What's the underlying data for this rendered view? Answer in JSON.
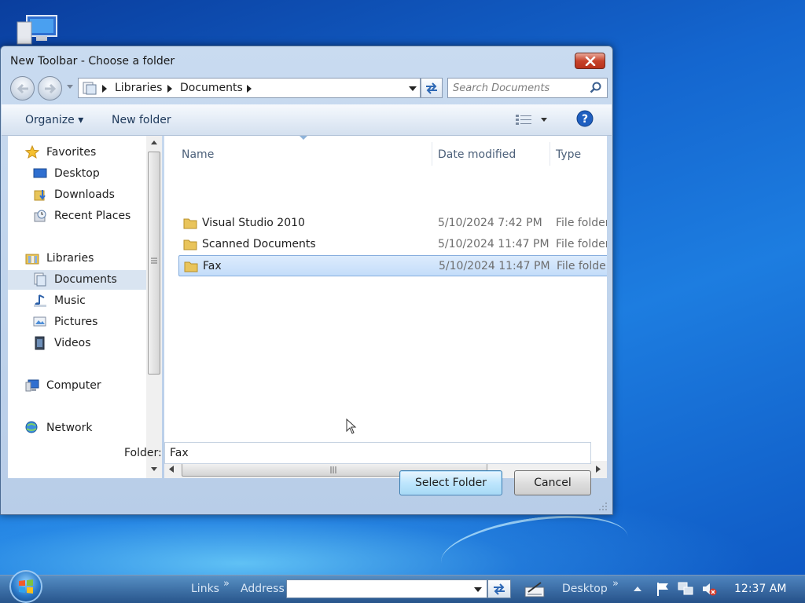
{
  "dialog": {
    "title": "New Toolbar - Choose a folder",
    "breadcrumb": [
      "Libraries",
      "Documents"
    ],
    "search_placeholder": "Search Documents",
    "toolbar": {
      "organize": "Organize",
      "organize_arrow": "▾",
      "new_folder": "New folder"
    }
  },
  "nav_pane": {
    "favorites": {
      "label": "Favorites",
      "items": [
        "Desktop",
        "Downloads",
        "Recent Places"
      ]
    },
    "libraries": {
      "label": "Libraries",
      "items": [
        "Documents",
        "Music",
        "Pictures",
        "Videos"
      ],
      "selected": "Documents"
    },
    "computer": "Computer",
    "network": "Network"
  },
  "file_list": {
    "columns": {
      "name": "Name",
      "date": "Date modified",
      "type": "Type"
    },
    "rows": [
      {
        "name": "Visual Studio 2010",
        "date": "5/10/2024 7:42 PM",
        "type": "File folder"
      },
      {
        "name": "Scanned Documents",
        "date": "5/10/2024 11:47 PM",
        "type": "File folder"
      },
      {
        "name": "Fax",
        "date": "5/10/2024 11:47 PM",
        "type": "File folder"
      }
    ],
    "selected_row": "Fax"
  },
  "footer": {
    "folder_label": "Folder:",
    "folder_value": "Fax",
    "select_button": "Select Folder",
    "cancel_button": "Cancel"
  },
  "taskbar": {
    "links": "Links",
    "address": "Address",
    "desktop": "Desktop",
    "chevron": "»",
    "clock": "12:37 AM"
  },
  "colors": {
    "selection": "#cce4fb",
    "desktop_blue": "#1466cf",
    "close_red": "#c7432b"
  }
}
